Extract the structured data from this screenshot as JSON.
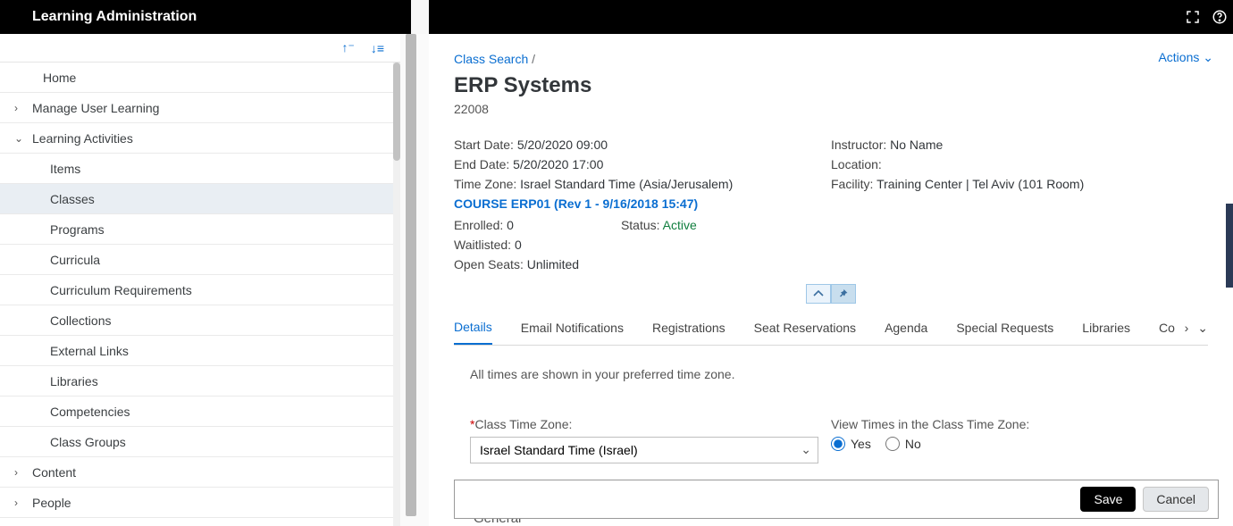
{
  "header": {
    "left_title": "Learning Administration"
  },
  "sidebar": {
    "items": [
      {
        "label": "Home"
      },
      {
        "label": "Manage User Learning"
      },
      {
        "label": "Learning Activities"
      },
      {
        "label": "Items"
      },
      {
        "label": "Classes"
      },
      {
        "label": "Programs"
      },
      {
        "label": "Curricula"
      },
      {
        "label": "Curriculum Requirements"
      },
      {
        "label": "Collections"
      },
      {
        "label": "External Links"
      },
      {
        "label": "Libraries"
      },
      {
        "label": "Competencies"
      },
      {
        "label": "Class Groups"
      },
      {
        "label": "Content"
      },
      {
        "label": "People"
      }
    ]
  },
  "breadcrumb": {
    "link": "Class Search",
    "sep": " /"
  },
  "actions_label": "Actions",
  "page": {
    "title": "ERP Systems",
    "id": "22008",
    "start_date_label": "Start Date:",
    "start_date": "5/20/2020 09:00",
    "end_date_label": "End Date:",
    "end_date": "5/20/2020 17:00",
    "tz_label": "Time Zone:",
    "tz": "Israel Standard Time (Asia/Jerusalem)",
    "course_link": "COURSE ERP01 (Rev 1 - 9/16/2018 15:47)",
    "instructor_label": "Instructor:",
    "instructor": "No Name",
    "location_label": "Location:",
    "location": "",
    "facility_label": "Facility:",
    "facility": "Training Center | Tel Aviv (101 Room)",
    "enrolled_label": "Enrolled:",
    "enrolled": "0",
    "status_label": "Status:",
    "status": "Active",
    "waitlisted_label": "Waitlisted:",
    "waitlisted": "0",
    "open_seats_label": "Open Seats:",
    "open_seats": "Unlimited"
  },
  "tabs": [
    "Details",
    "Email Notifications",
    "Registrations",
    "Seat Reservations",
    "Agenda",
    "Special Requests",
    "Libraries",
    "Co"
  ],
  "details": {
    "note": "All times are shown in your preferred time zone.",
    "class_tz_label": "Class Time Zone:",
    "class_tz_value": "Israel Standard Time (Israel)",
    "view_times_label": "View Times in the Class Time Zone:",
    "yes": "Yes",
    "no": "No",
    "general": "General"
  },
  "footer": {
    "save": "Save",
    "cancel": "Cancel"
  }
}
